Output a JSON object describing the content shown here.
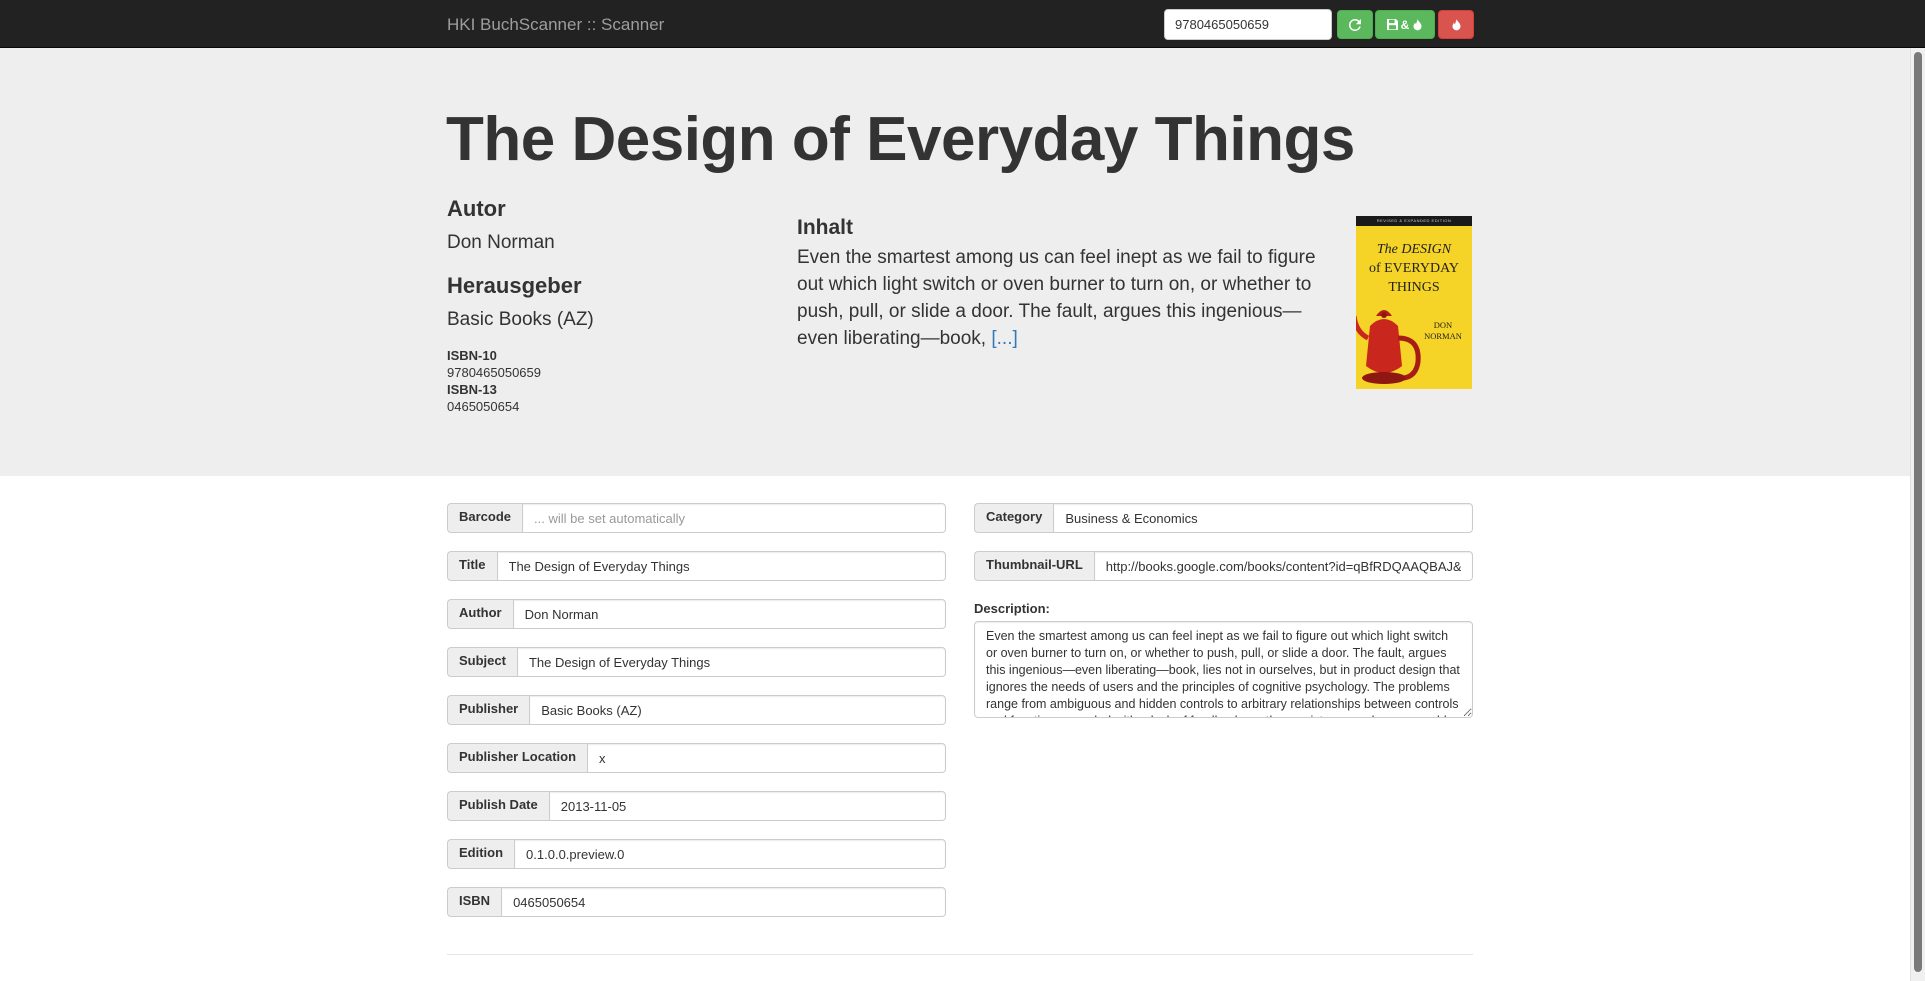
{
  "navbar": {
    "brand": "HKI BuchScanner :: Scanner",
    "search_value": "9780465050659",
    "refresh_icon": "refresh-icon",
    "save_label": "&",
    "save_icons": [
      "floppy-disk-icon",
      "fire-icon"
    ],
    "burn_icon": "fire-icon",
    "colors": {
      "navbar": "#222222",
      "success": "#5cb85c",
      "danger": "#d9534f"
    }
  },
  "book": {
    "title": "The Design of Everyday Things",
    "author_heading": "Autor",
    "author": "Don Norman",
    "publisher_heading": "Herausgeber",
    "publisher": "Basic Books (AZ)",
    "isbn10_label": "ISBN-10",
    "isbn10": "9780465050659",
    "isbn13_label": "ISBN-13",
    "isbn13": "0465050654",
    "summary_heading": "Inhalt",
    "summary": "Even the smartest among us can feel inept as we fail to figure out which light switch or oven burner to turn on, or whether to push, pull, or slide a door. The fault, argues this ingenious—even liberating—book,",
    "more_link": "[...]",
    "cover": {
      "band_text": "REVISED & EXPANDED EDITION",
      "title_lines": [
        "The DESIGN",
        "of EVERYDAY",
        "THINGS"
      ],
      "author_lines": [
        "DON",
        "NORMAN"
      ]
    }
  },
  "form": {
    "left": [
      {
        "label": "Barcode",
        "value": "",
        "placeholder": "... will be set automatically"
      },
      {
        "label": "Title",
        "value": "The Design of Everyday Things",
        "placeholder": ""
      },
      {
        "label": "Author",
        "value": "Don Norman",
        "placeholder": ""
      },
      {
        "label": "Subject",
        "value": "The Design of Everyday Things",
        "placeholder": ""
      },
      {
        "label": "Publisher",
        "value": "Basic Books (AZ)",
        "placeholder": ""
      },
      {
        "label": "Publisher Location",
        "value": "x",
        "placeholder": ""
      },
      {
        "label": "Publish Date",
        "value": "2013-11-05",
        "placeholder": ""
      },
      {
        "label": "Edition",
        "value": "0.1.0.0.preview.0",
        "placeholder": ""
      },
      {
        "label": "ISBN",
        "value": "0465050654",
        "placeholder": ""
      }
    ],
    "right": [
      {
        "label": "Category",
        "value": "Business & Economics",
        "placeholder": ""
      },
      {
        "label": "Thumbnail-URL",
        "value": "http://books.google.com/books/content?id=qBfRDQAAQBAJ&p",
        "placeholder": ""
      }
    ],
    "description_label": "Description:",
    "description": "Even the smartest among us can feel inept as we fail to figure out which light switch or oven burner to turn on, or whether to push, pull, or slide a door. The fault, argues this ingenious—even liberating—book, lies not in ourselves, but in product design that ignores the needs of users and the principles of cognitive psychology. The problems range from ambiguous and hidden controls to arbitrary relationships between controls and functions, coupled with a lack of feedback or other assistance and unreasonable demands on memorization."
  }
}
